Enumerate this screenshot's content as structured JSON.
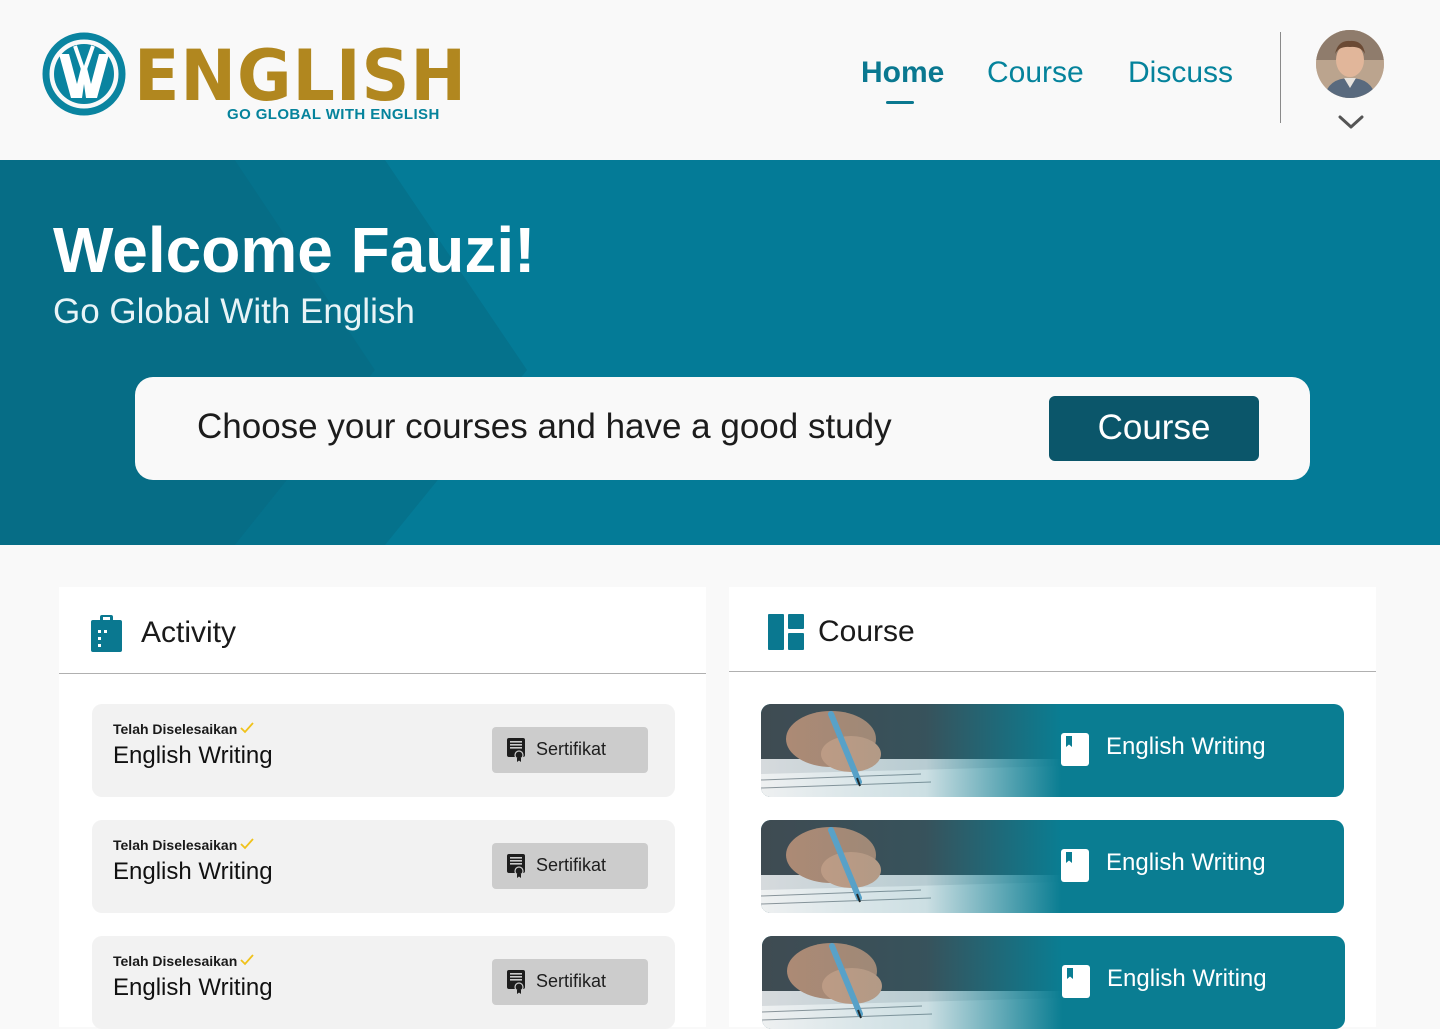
{
  "brand": {
    "logo_letter": "W",
    "name": "ENGLISH",
    "tagline": "GO GLOBAL WITH ENGLISH",
    "colors": {
      "primary": "#05839c",
      "gold": "#b1871f",
      "dark": "#0b566a"
    }
  },
  "nav": {
    "items": [
      {
        "label": "Home",
        "active": true
      },
      {
        "label": "Course",
        "active": false
      },
      {
        "label": "Discuss",
        "active": false
      }
    ],
    "avatar_icon": "user-avatar",
    "dropdown_icon": "chevron-down-icon"
  },
  "hero": {
    "title": "Welcome Fauzi!",
    "subtitle": "Go Global With English",
    "card_text": "Choose your courses and have a good study",
    "button_label": "Course"
  },
  "activity": {
    "title": "Activity",
    "icon": "clipboard-icon",
    "items": [
      {
        "status": "Telah Diselesaikan",
        "course": "English Writing",
        "button": "Sertifikat"
      },
      {
        "status": "Telah Diselesaikan",
        "course": "English Writing",
        "button": "Sertifikat"
      },
      {
        "status": "Telah Diselesaikan",
        "course": "English Writing",
        "button": "Sertifikat"
      }
    ]
  },
  "course": {
    "title": "Course",
    "icon": "dashboard-icon",
    "items": [
      {
        "label": "English Writing",
        "icon": "book-icon"
      },
      {
        "label": "English Writing",
        "icon": "book-icon"
      },
      {
        "label": "English Writing",
        "icon": "book-icon"
      }
    ]
  }
}
